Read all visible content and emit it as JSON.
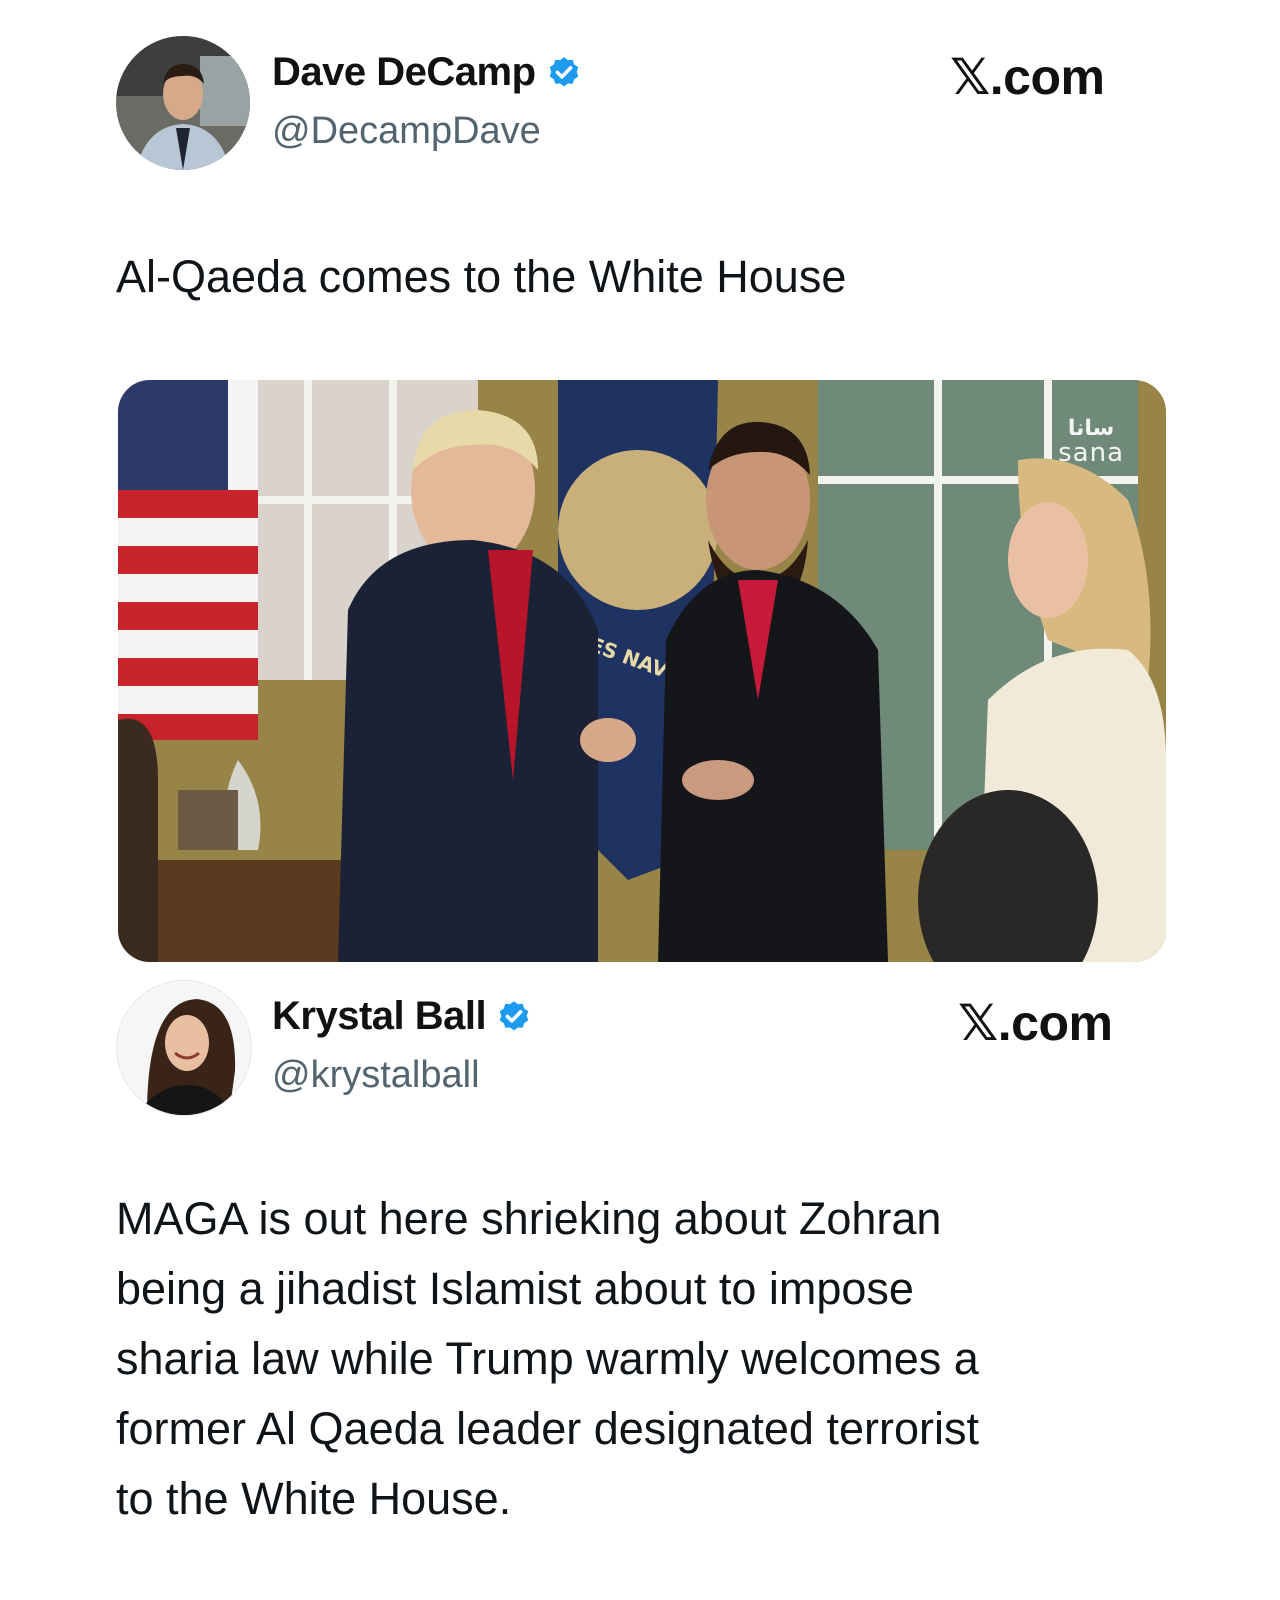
{
  "tweet1": {
    "display_name": "Dave DeCamp",
    "handle": "@DecampDave",
    "source": "𝕏.com",
    "text": "Al-Qaeda comes to the White House",
    "verified": true,
    "avatar_icon": "avatar-man-in-car",
    "media": {
      "watermark_arabic": "سانا",
      "watermark_latin": "sana",
      "flag_text": "ES NAVY"
    }
  },
  "tweet2": {
    "display_name": "Krystal Ball",
    "handle": "@krystalball",
    "source": "𝕏.com",
    "verified": true,
    "avatar_icon": "avatar-woman-smiling",
    "text_lines": [
      "MAGA is out here shrieking about Zohran",
      "being a jihadist Islamist about to impose",
      "sharia law while Trump warmly welcomes a",
      "former Al Qaeda leader designated terrorist",
      "to the White House."
    ]
  },
  "colors": {
    "verified_blue": "#1d9bf0",
    "handle_gray": "#536471",
    "text": "#0f1419"
  }
}
